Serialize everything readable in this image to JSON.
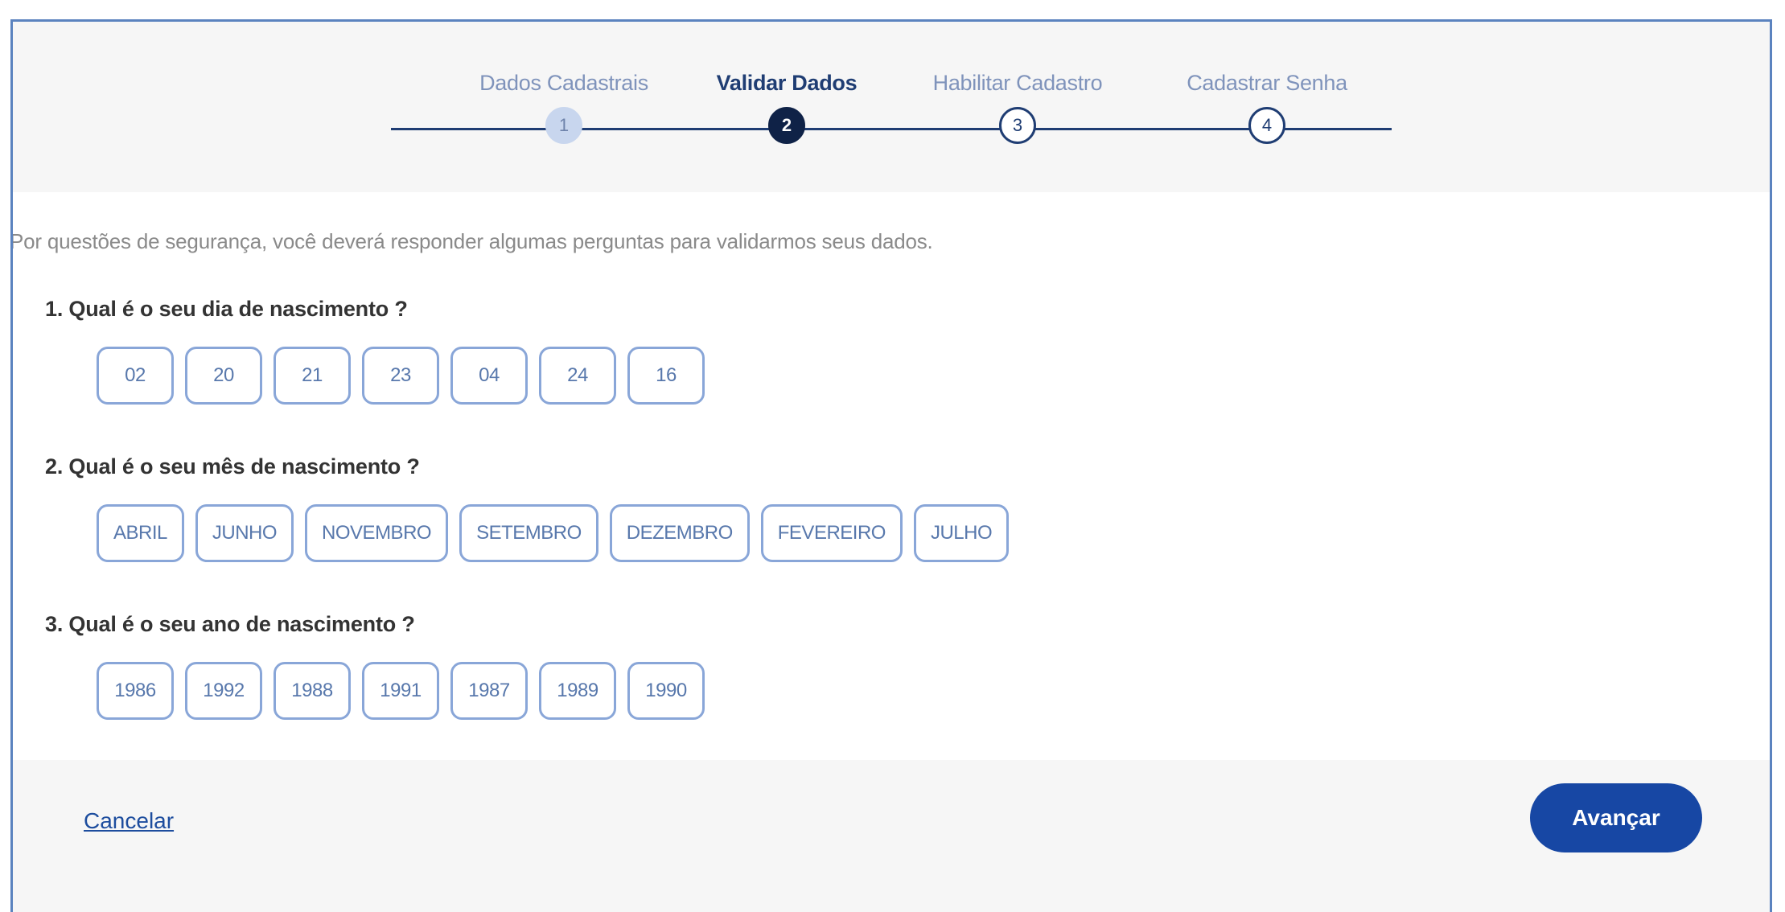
{
  "stepper": {
    "steps": [
      {
        "label": "Dados Cadastrais",
        "number": "1",
        "state": "done"
      },
      {
        "label": "Validar Dados",
        "number": "2",
        "state": "active"
      },
      {
        "label": "Habilitar Cadastro",
        "number": "3",
        "state": "pending"
      },
      {
        "label": "Cadastrar Senha",
        "number": "4",
        "state": "pending"
      }
    ]
  },
  "intro": "Por questões de segurança, você deverá responder algumas perguntas para validarmos seus dados.",
  "questions": [
    {
      "text": "1. Qual é o seu dia de nascimento ?",
      "options": [
        "02",
        "20",
        "21",
        "23",
        "04",
        "24",
        "16"
      ]
    },
    {
      "text": "2. Qual é o seu mês de nascimento ?",
      "options": [
        "ABRIL",
        "JUNHO",
        "NOVEMBRO",
        "SETEMBRO",
        "DEZEMBRO",
        "FEVEREIRO",
        "JULHO"
      ]
    },
    {
      "text": "3. Qual é o seu ano de nascimento ?",
      "options": [
        "1986",
        "1992",
        "1988",
        "1991",
        "1987",
        "1989",
        "1990"
      ]
    }
  ],
  "footer": {
    "cancel_label": "Cancelar",
    "next_label": "Avançar"
  },
  "colors": {
    "primary": "#1747a4",
    "step_active": "#0f2247",
    "step_done": "#c8d6ee",
    "option_border": "#89a6d8",
    "panel_bg": "#f6f6f6"
  }
}
